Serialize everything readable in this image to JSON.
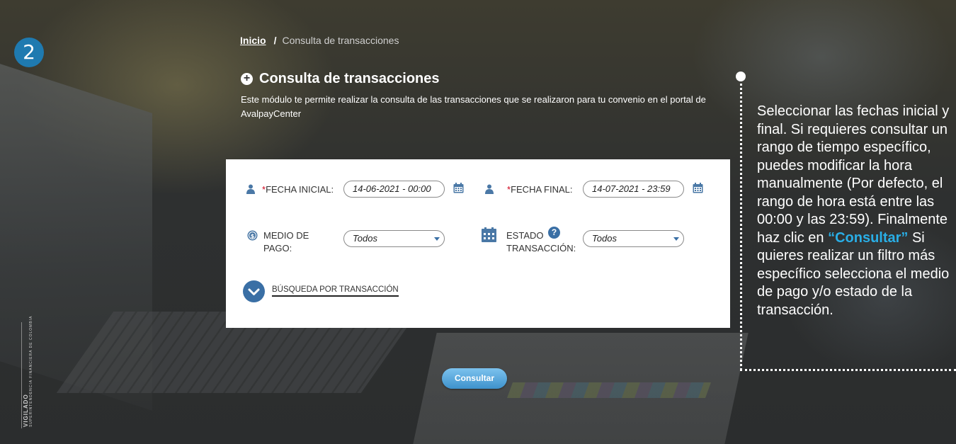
{
  "step": {
    "number": "2"
  },
  "breadcrumb": {
    "home": "Inicio",
    "separator": "/",
    "current": "Consulta de transacciones"
  },
  "page": {
    "title": "Consulta de transacciones",
    "description": "Este módulo te permite realizar la consulta de las transacciones que se realizaron para tu convenio en el portal de AvalpayCenter"
  },
  "form": {
    "fecha_inicial": {
      "required_mark": "*",
      "label": "FECHA INICIAL:",
      "value": "14-06-2021 - 00:00"
    },
    "fecha_final": {
      "required_mark": "*",
      "label": "FECHA FINAL:",
      "value": "14-07-2021 - 23:59"
    },
    "medio_pago": {
      "label_line1": "MEDIO DE",
      "label_line2": "PAGO:",
      "selected": "Todos"
    },
    "estado": {
      "label_line1": "ESTADO",
      "label_line2": "TRANSACCIÓN:",
      "selected": "Todos",
      "help": "?"
    },
    "busqueda_label": "BÚSQUEDA POR TRANSACCIÓN",
    "submit_label": "Consultar"
  },
  "note": {
    "part1": "Seleccionar las fechas inicial y final. Si requieres consultar un rango de tiempo específico, puedes modificar la hora manualmente (Por defecto, el rango de hora está entre las 00:00 y las 23:59). Finalmente haz clic en ",
    "highlight": "“Consultar”",
    "part2": " Si quieres realizar un filtro más específico selecciona el medio de pago y/o estado de la transacción."
  },
  "footer": {
    "vigilado": "VIGILADO",
    "superintendencia": "SUPERINTENDENCIA FINANCIERA DE COLOMBIA"
  },
  "colors": {
    "accent": "#3a6fa5",
    "highlight": "#29aee6",
    "badge": "#1f7ab0",
    "required": "#d0021b"
  }
}
